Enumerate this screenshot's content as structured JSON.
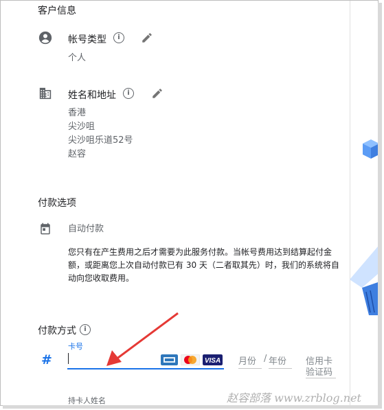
{
  "customer_info": {
    "header": "客户信息",
    "account_type": {
      "label": "帐号类型",
      "value": "个人"
    },
    "name_address": {
      "label": "姓名和地址",
      "lines": [
        "香港",
        "尖沙咀",
        "尖沙咀乐道52号",
        "赵容"
      ]
    }
  },
  "payment_options": {
    "header": "付款选项",
    "auto_pay_label": "自动付款",
    "description": "您只有在产生费用之后才需要为此服务付款。当帐号费用达到结算起付金额，或距离您上次自动付款已有 30 天（二者取其先）时，我们的系统将自动向您收取费用。"
  },
  "payment_method": {
    "header": "付款方式",
    "card_number_label": "卡号",
    "card_number_value": "",
    "hash_symbol": "#",
    "card_brands": [
      "AMEX",
      "MasterCard",
      "VISA"
    ],
    "month_placeholder": "月份",
    "separator": "/",
    "year_placeholder": "年份",
    "cvc_placeholder_line1": "信用卡",
    "cvc_placeholder_line2": "验证码",
    "cardholder_label": "持卡人姓名"
  },
  "watermark": "赵容部落 www.zrblog.net",
  "colors": {
    "accent": "#1a73e8",
    "arrow": "#e53935",
    "icon": "#5f6368",
    "decor_blue": "#5b9cf5"
  },
  "icons": [
    "account-circle-icon",
    "edit-icon",
    "info-icon",
    "business-icon",
    "calendar-icon",
    "credit-card-hash-icon"
  ]
}
